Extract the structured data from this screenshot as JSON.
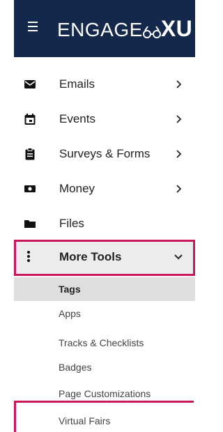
{
  "header": {
    "brand_text": "ENGAGE",
    "brand_suffix": "XU"
  },
  "menu": [
    {
      "label": "Emails",
      "icon": "envelope-icon",
      "has_arrow": true
    },
    {
      "label": "Events",
      "icon": "calendar-icon",
      "has_arrow": true
    },
    {
      "label": "Surveys & Forms",
      "icon": "clipboard-icon",
      "has_arrow": true
    },
    {
      "label": "Money",
      "icon": "money-icon",
      "has_arrow": true
    },
    {
      "label": "Files",
      "icon": "folder-icon",
      "has_arrow": false
    }
  ],
  "more_tools": {
    "label": "More Tools",
    "icon": "vertical-dots-icon",
    "expanded": true
  },
  "submenu": [
    {
      "label": "Tags",
      "active": true
    },
    {
      "label": "Apps"
    },
    {
      "label": "Tracks & Checklists"
    },
    {
      "label": "Badges"
    },
    {
      "label": "Page Customizations"
    },
    {
      "label": "Virtual Fairs"
    }
  ],
  "colors": {
    "header_bg": "#14284b",
    "highlight": "#c8175d",
    "active_bg": "#dedede"
  }
}
